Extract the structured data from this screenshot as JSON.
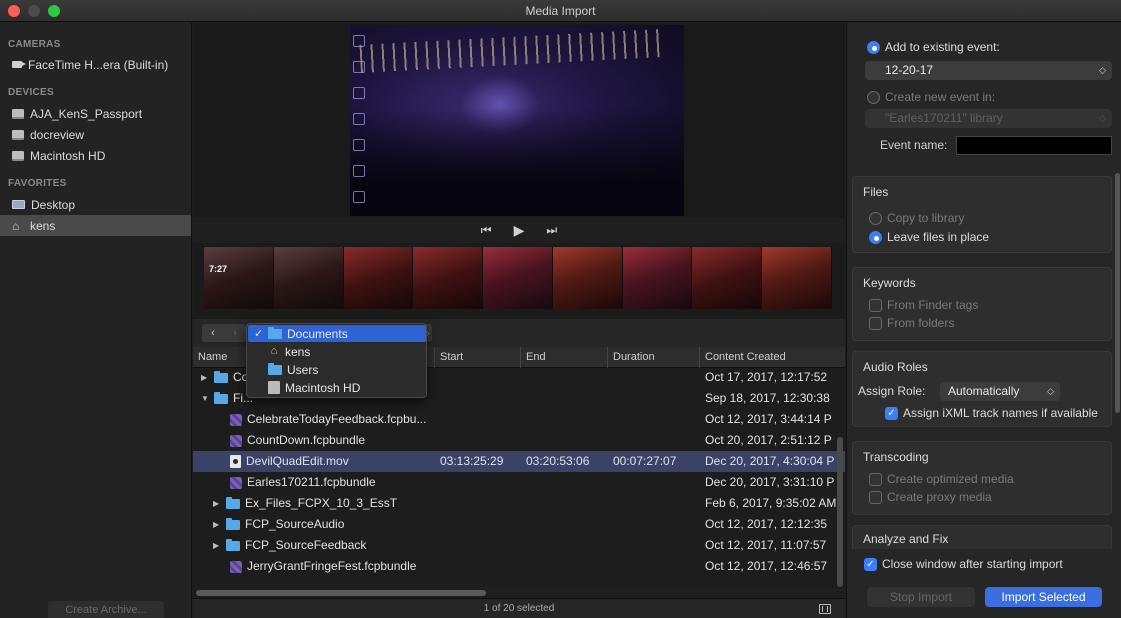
{
  "window": {
    "title": "Media Import"
  },
  "sidebar": {
    "sections": [
      {
        "heading": "CAMERAS",
        "items": [
          {
            "label": "FaceTime H...era (Built-in)",
            "icon": "camera-icon"
          }
        ]
      },
      {
        "heading": "DEVICES",
        "items": [
          {
            "label": "AJA_KenS_Passport",
            "icon": "disk-icon"
          },
          {
            "label": "docreview",
            "icon": "disk-icon"
          },
          {
            "label": "Macintosh HD",
            "icon": "disk-icon"
          }
        ]
      },
      {
        "heading": "FAVORITES",
        "items": [
          {
            "label": "Desktop",
            "icon": "desktop-icon"
          },
          {
            "label": "kens",
            "icon": "home-icon",
            "selected": true
          }
        ]
      }
    ],
    "archive_button": "Create Archive..."
  },
  "filmstrip": {
    "timecode": "7:27"
  },
  "path_menu": {
    "items": [
      {
        "label": "Documents",
        "checked": true,
        "icon": "folder-icon"
      },
      {
        "label": "kens",
        "icon": "home-icon"
      },
      {
        "label": "Users",
        "icon": "folder-icon"
      },
      {
        "label": "Macintosh HD",
        "icon": "hard-drive-icon"
      }
    ]
  },
  "table": {
    "columns": [
      "Name",
      "Start",
      "End",
      "Duration",
      "Content Created"
    ],
    "rows": [
      {
        "name": "Co...",
        "type": "folder",
        "disclosure": "collapsed",
        "indent": 0,
        "start": "",
        "end": "",
        "duration": "",
        "created": "Oct 17, 2017, 12:17:52"
      },
      {
        "name": "Fi...",
        "type": "folder",
        "disclosure": "expanded",
        "indent": 0,
        "start": "",
        "end": "",
        "duration": "",
        "created": "Sep 18, 2017, 12:30:38"
      },
      {
        "name": "CelebrateTodayFeedback.fcpbu...",
        "type": "bundle",
        "indent": 1,
        "start": "",
        "end": "",
        "duration": "",
        "created": "Oct 12, 2017, 3:44:14 P"
      },
      {
        "name": "CountDown.fcpbundle",
        "type": "bundle",
        "indent": 1,
        "start": "",
        "end": "",
        "duration": "",
        "created": "Oct 20, 2017, 2:51:12 P"
      },
      {
        "name": "DevilQuadEdit.mov",
        "type": "movie",
        "indent": 1,
        "selected": true,
        "start": "03:13:25:29",
        "end": "03:20:53:06",
        "duration": "00:07:27:07",
        "created": "Dec 20, 2017, 4:30:04 P"
      },
      {
        "name": "Earles170211.fcpbundle",
        "type": "bundle",
        "indent": 1,
        "start": "",
        "end": "",
        "duration": "",
        "created": "Dec 20, 2017, 3:31:10 P"
      },
      {
        "name": "Ex_Files_FCPX_10_3_EssT",
        "type": "folder",
        "disclosure": "collapsed",
        "indent": 1,
        "start": "",
        "end": "",
        "duration": "",
        "created": "Feb 6, 2017, 9:35:02 AM"
      },
      {
        "name": "FCP_SourceAudio",
        "type": "folder",
        "disclosure": "collapsed",
        "indent": 1,
        "start": "",
        "end": "",
        "duration": "",
        "created": "Oct 12, 2017, 12:12:35"
      },
      {
        "name": "FCP_SourceFeedback",
        "type": "folder",
        "disclosure": "collapsed",
        "indent": 1,
        "start": "",
        "end": "",
        "duration": "",
        "created": "Oct 12, 2017, 11:07:57"
      },
      {
        "name": "JerryGrantFringeFest.fcpbundle",
        "type": "bundle",
        "indent": 1,
        "start": "",
        "end": "",
        "duration": "",
        "created": "Oct 12, 2017, 12:46:57"
      }
    ],
    "status": "1 of 20 selected"
  },
  "import_panel": {
    "add_existing_label": "Add to existing event:",
    "existing_event_value": "12-20-17",
    "create_new_label": "Create new event in:",
    "new_event_library": "\"Earles170211\" library",
    "event_name_label": "Event name:",
    "files": {
      "title": "Files",
      "copy_label": "Copy to library",
      "leave_label": "Leave files in place"
    },
    "keywords": {
      "title": "Keywords",
      "finder_tags_label": "From Finder tags",
      "folders_label": "From folders"
    },
    "audio_roles": {
      "title": "Audio Roles",
      "assign_label": "Assign Role:",
      "assign_value": "Automatically",
      "ixml_label": "Assign iXML track names if available"
    },
    "transcoding": {
      "title": "Transcoding",
      "optimized_label": "Create optimized media",
      "proxy_label": "Create proxy media"
    },
    "analyze": {
      "title": "Analyze and Fix"
    },
    "close_window_label": "Close window after starting import",
    "stop_button": "Stop Import",
    "import_button": "Import Selected"
  },
  "colors": {
    "accent": "#3b7ef5",
    "selection_row": "#3b4268",
    "menu_highlight": "#2d63d6"
  }
}
